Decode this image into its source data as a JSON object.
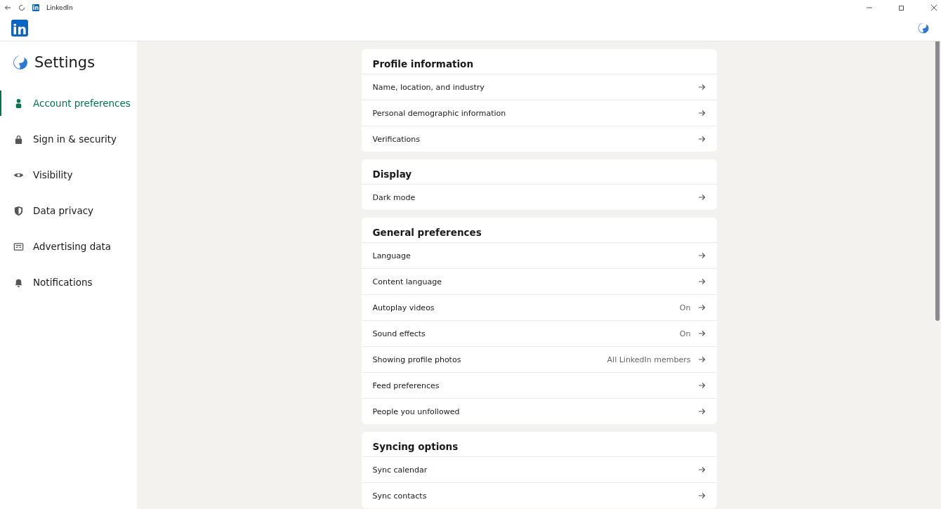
{
  "window": {
    "title": "LinkedIn",
    "title_icon": "in"
  },
  "header": {
    "logo": "in"
  },
  "sidebar": {
    "title": "Settings",
    "items": [
      {
        "label": "Account preferences",
        "selected": true
      },
      {
        "label": "Sign in & security",
        "selected": false
      },
      {
        "label": "Visibility",
        "selected": false
      },
      {
        "label": "Data privacy",
        "selected": false
      },
      {
        "label": "Advertising data",
        "selected": false
      },
      {
        "label": "Notifications",
        "selected": false
      }
    ]
  },
  "sections": [
    {
      "title": "Profile information",
      "rows": [
        {
          "label": "Name, location, and industry"
        },
        {
          "label": "Personal demographic information"
        },
        {
          "label": "Verifications"
        }
      ]
    },
    {
      "title": "Display",
      "rows": [
        {
          "label": "Dark mode"
        }
      ]
    },
    {
      "title": "General preferences",
      "rows": [
        {
          "label": "Language"
        },
        {
          "label": "Content language"
        },
        {
          "label": "Autoplay videos",
          "value": "On"
        },
        {
          "label": "Sound effects",
          "value": "On"
        },
        {
          "label": "Showing profile photos",
          "value": "All LinkedIn members"
        },
        {
          "label": "Feed preferences"
        },
        {
          "label": "People you unfollowed"
        }
      ]
    },
    {
      "title": "Syncing options",
      "rows": [
        {
          "label": "Sync calendar"
        },
        {
          "label": "Sync contacts"
        }
      ]
    }
  ]
}
